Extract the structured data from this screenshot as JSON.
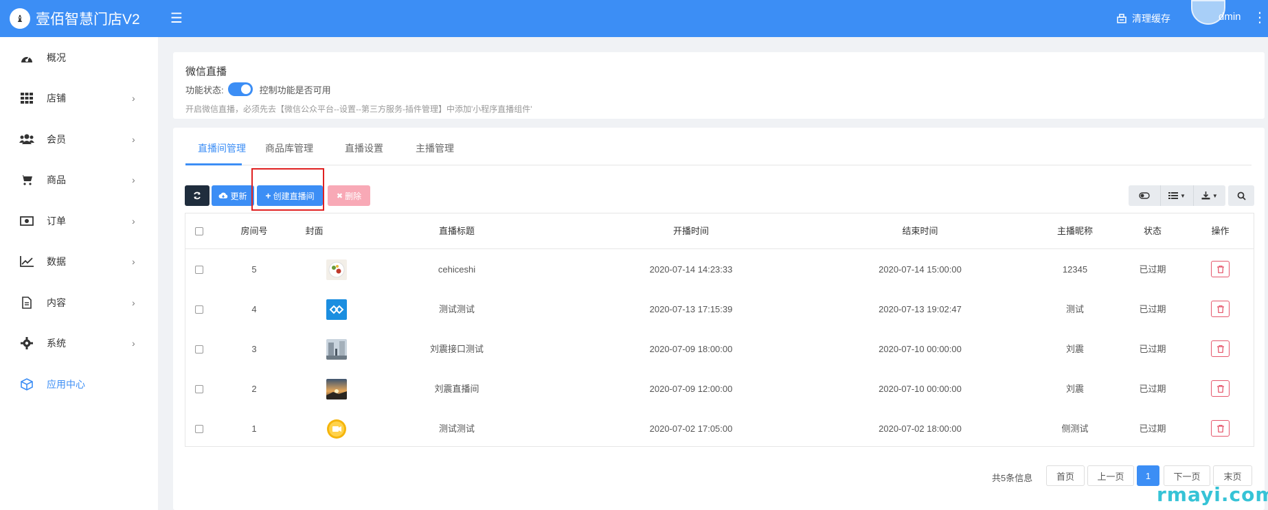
{
  "header": {
    "logo_mark": "♝",
    "app_title": "壹佰智慧门店V2",
    "clear_cache": "清理缓存",
    "user": "dmin"
  },
  "sidebar": {
    "items": [
      {
        "label": "概况",
        "icon": "dashboard-icon",
        "has_arrow": false
      },
      {
        "label": "店铺",
        "icon": "grid-icon",
        "has_arrow": true
      },
      {
        "label": "会员",
        "icon": "users-icon",
        "has_arrow": true
      },
      {
        "label": "商品",
        "icon": "cart-icon",
        "has_arrow": true
      },
      {
        "label": "订单",
        "icon": "money-icon",
        "has_arrow": true
      },
      {
        "label": "数据",
        "icon": "chart-line-icon",
        "has_arrow": true
      },
      {
        "label": "内容",
        "icon": "document-icon",
        "has_arrow": true
      },
      {
        "label": "系统",
        "icon": "gear-icon",
        "has_arrow": true
      },
      {
        "label": "应用中心",
        "icon": "cube-icon",
        "has_arrow": false,
        "active": true
      }
    ]
  },
  "info": {
    "title": "微信直播",
    "status_label": "功能状态:",
    "status_desc": "控制功能是否可用",
    "hint": "开启微信直播，必须先去【微信公众平台--设置--第三方服务-插件管理】中添加'小程序直播组件'",
    "enabled": true
  },
  "tabs": [
    "直播间管理",
    "商品库管理",
    "直播设置",
    "主播管理"
  ],
  "toolbar": {
    "update": "更新",
    "create": "创建直播间",
    "delete": "删除"
  },
  "table": {
    "columns": [
      "房间号",
      "封面",
      "直播标题",
      "开播时间",
      "结束时间",
      "主播昵称",
      "状态",
      "操作"
    ],
    "rows": [
      {
        "room": "5",
        "cover": "food-thumb",
        "title": "cehiceshi",
        "start": "2020-07-14 14:23:33",
        "end": "2020-07-14 15:00:00",
        "anchor": "12345",
        "status": "已过期"
      },
      {
        "room": "4",
        "cover": "logo-thumb",
        "title": "测试测试",
        "start": "2020-07-13 17:15:39",
        "end": "2020-07-13 19:02:47",
        "anchor": "测试",
        "status": "已过期"
      },
      {
        "room": "3",
        "cover": "street-thumb",
        "title": "刘震接口测试",
        "start": "2020-07-09 18:00:00",
        "end": "2020-07-10 00:00:00",
        "anchor": "刘震",
        "status": "已过期"
      },
      {
        "room": "2",
        "cover": "sunset-thumb",
        "title": "刘震直播间",
        "start": "2020-07-09 12:00:00",
        "end": "2020-07-10 00:00:00",
        "anchor": "刘震",
        "status": "已过期"
      },
      {
        "room": "1",
        "cover": "video-thumb",
        "title": "测试测试",
        "start": "2020-07-02 17:05:00",
        "end": "2020-07-02 18:00:00",
        "anchor": "侧测试",
        "status": "已过期"
      }
    ]
  },
  "pagination": {
    "info": "共5条信息",
    "first": "首页",
    "prev": "上一页",
    "current": "1",
    "next": "下一页",
    "last": "末页"
  },
  "watermark": "rmayi.com",
  "colors": {
    "primary": "#3c8ef5",
    "danger": "#e5566b",
    "dark": "#1f2d3d"
  }
}
